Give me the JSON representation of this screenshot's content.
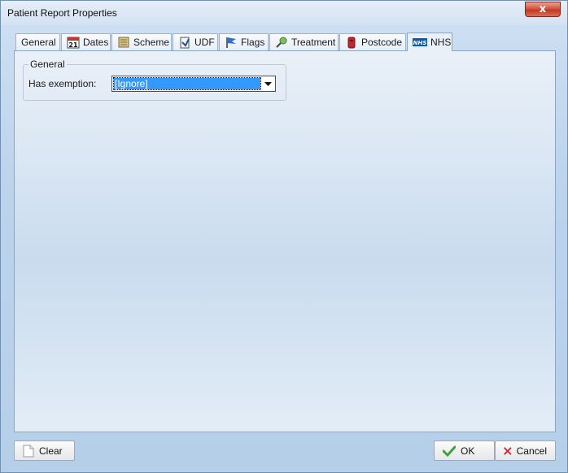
{
  "window": {
    "title": "Patient Report Properties",
    "close_label": "x"
  },
  "tabs": [
    {
      "label": "General",
      "icon": "none"
    },
    {
      "label": "Dates",
      "icon": "calendar-icon",
      "icon_text": "21"
    },
    {
      "label": "Scheme",
      "icon": "scheme-icon"
    },
    {
      "label": "UDF",
      "icon": "udf-icon"
    },
    {
      "label": "Flags",
      "icon": "flag-icon"
    },
    {
      "label": "Treatment",
      "icon": "treatment-icon"
    },
    {
      "label": "Postcode",
      "icon": "postbox-icon"
    },
    {
      "label": "NHS",
      "icon": "nhs-logo-icon",
      "icon_text": "NHS",
      "active": true
    }
  ],
  "group": {
    "legend": "General",
    "exemption_label": "Has exemption:",
    "exemption_value": "[Ignore]"
  },
  "buttons": {
    "clear": "Clear",
    "ok": "OK",
    "cancel": "Cancel"
  },
  "colors": {
    "selection": "#3399ff",
    "panel": "#c9dbee",
    "nhs_blue": "#005eb8"
  }
}
